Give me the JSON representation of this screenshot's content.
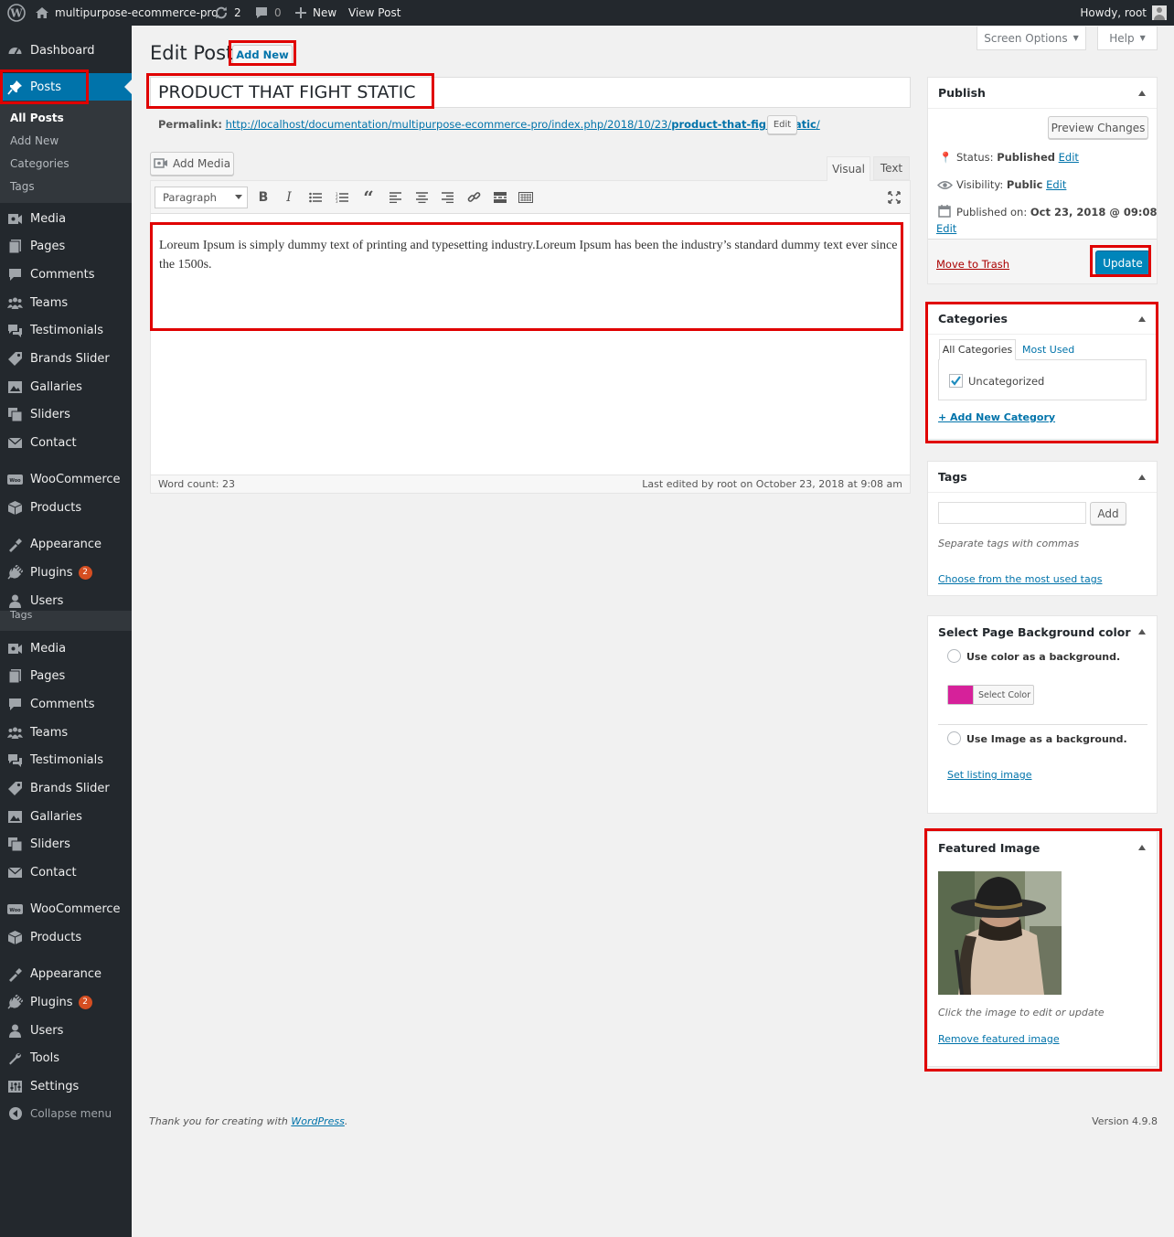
{
  "adminbar": {
    "site_name": "multipurpose-ecommerce-pro",
    "updates_count": "2",
    "comments_count": "0",
    "new_label": "New",
    "view_post_label": "View Post",
    "greeting": "Howdy, root"
  },
  "sidebar": {
    "dashboard": "Dashboard",
    "posts": "Posts",
    "posts_sub": [
      "All Posts",
      "Add New",
      "Categories",
      "Tags"
    ],
    "items1": [
      "Media",
      "Pages",
      "Comments",
      "Teams",
      "Testimonials",
      "Brands Slider",
      "Gallaries",
      "Sliders",
      "Contact"
    ],
    "woocommerce": "WooCommerce",
    "products": "Products",
    "appearance": "Appearance",
    "plugins": "Plugins",
    "plugins_badge": "2",
    "users": "Users",
    "overlap_tags": "Tags",
    "items2": [
      "Media",
      "Pages",
      "Comments",
      "Teams",
      "Testimonials",
      "Brands Slider",
      "Gallaries",
      "Sliders",
      "Contact"
    ],
    "woocommerce2": "WooCommerce",
    "products2": "Products",
    "appearance2": "Appearance",
    "plugins2": "Plugins",
    "plugins_badge2": "2",
    "users2": "Users",
    "tools": "Tools",
    "settings": "Settings",
    "collapse": "Collapse menu"
  },
  "header": {
    "title": "Edit Post",
    "add_new": "Add New",
    "screen_options": "Screen Options",
    "help": "Help"
  },
  "post": {
    "title": "PRODUCT THAT FIGHT STATIC",
    "permalink_label": "Permalink:",
    "permalink_base": "http://localhost/documentation/multipurpose-ecommerce-pro/index.php/2018/10/23/",
    "permalink_slug": "product-that-fight-static",
    "permalink_end": "/",
    "permalink_edit": "Edit",
    "add_media": "Add Media",
    "tab_visual": "Visual",
    "tab_text": "Text",
    "format_select": "Paragraph",
    "content": "Loreum Ipsum is simply dummy text of printing and typesetting industry.Loreum Ipsum has been the industry’s standard dummy text ever since the 1500s.",
    "word_count": "Word count: 23",
    "last_edited": "Last edited by root on October 23, 2018 at 9:08 am"
  },
  "publish": {
    "title": "Publish",
    "preview": "Preview Changes",
    "status_label": "Status:",
    "status_value": "Published",
    "visibility_label": "Visibility:",
    "visibility_value": "Public",
    "published_label": "Published on:",
    "published_value": "Oct 23, 2018 @ 09:08",
    "edit": "Edit",
    "trash": "Move to Trash",
    "update": "Update"
  },
  "categories": {
    "title": "Categories",
    "tab_all": "All Categories",
    "tab_most": "Most Used",
    "items": [
      {
        "label": "Uncategorized",
        "checked": true
      }
    ],
    "add_new": "+ Add New Category"
  },
  "tags": {
    "title": "Tags",
    "add": "Add",
    "hint": "Separate tags with commas",
    "choose": "Choose from the most used tags"
  },
  "bgcolor": {
    "title": "Select Page Background color",
    "use_color": "Use color as a background.",
    "select_color": "Select Color",
    "swatch": "#d6219a",
    "use_image": "Use Image as a background.",
    "set_image": "Set listing image"
  },
  "featured": {
    "title": "Featured Image",
    "hint": "Click the image to edit or update",
    "remove": "Remove featured image"
  },
  "footer": {
    "thanks": "Thank you for creating with",
    "wp_link": "WordPress",
    "period": ".",
    "version": "Version 4.9.8"
  },
  "colors": {
    "admin_dark": "#23282d",
    "accent": "#0073aa",
    "highlight": "#e00000",
    "trash": "#a00000"
  }
}
